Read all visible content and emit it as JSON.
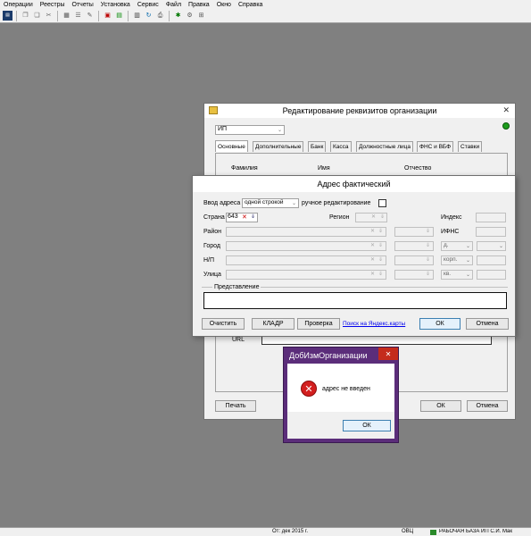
{
  "menu": [
    "Операции",
    "Реестры",
    "Отчеты",
    "Установка",
    "Сервис",
    "Файл",
    "Правка",
    "Окно",
    "Справка"
  ],
  "toolbar_icons": [
    "app-icon",
    "copy-icon",
    "paste-icon",
    "cut-icon",
    "table-icon",
    "list-icon",
    "edit-icon",
    "calendar-icon",
    "doc-icon",
    "calc-icon",
    "refresh-icon",
    "print-icon",
    "gear-icon",
    "grid-icon"
  ],
  "org_window": {
    "title": "Редактирование реквизитов организации",
    "type_value": "ИП",
    "tabs": [
      "Основные",
      "Дополнительные",
      "Банк",
      "Касса",
      "Должностные лица",
      "ФНС и ВБФ",
      "Ставки"
    ],
    "col_headers": [
      "Фамилия",
      "Имя",
      "Отчество"
    ],
    "url_label": "URL",
    "print_button": "Печать",
    "ok_button": "ОК",
    "cancel_button": "Отмена"
  },
  "address_window": {
    "title": "Адрес фактический",
    "input_mode_label": "Ввод адреса",
    "input_mode_value": "одной строкой",
    "manual_edit_label": "ручное редактирование",
    "country_label": "Страна",
    "country_value": "643",
    "region_label": "Регион",
    "index_label": "Индекс",
    "district_label": "Район",
    "ifns_label": "ИФНС",
    "city_label": "Город",
    "house_value": "д.",
    "np_label": "Н/П",
    "building_value": "корп.",
    "street_label": "Улица",
    "apt_value": "кв.",
    "representation_label": "Представление",
    "clear_button": "Очистить",
    "kladr_button": "КЛАДР",
    "check_button": "Проверка",
    "yandex_link": "Поиск на Яндекс.карты",
    "ok_button": "ОК",
    "cancel_button": "Отмена"
  },
  "error_dialog": {
    "title": "ДобИзмОрганизации",
    "message": "адрес не введен",
    "ok_button": "ОК"
  },
  "status": {
    "date": "От: дек 2015 г.",
    "mode": "ОВЦ",
    "db": "РАБОЧАЯ БАЗА ИП С.И. Мак"
  }
}
